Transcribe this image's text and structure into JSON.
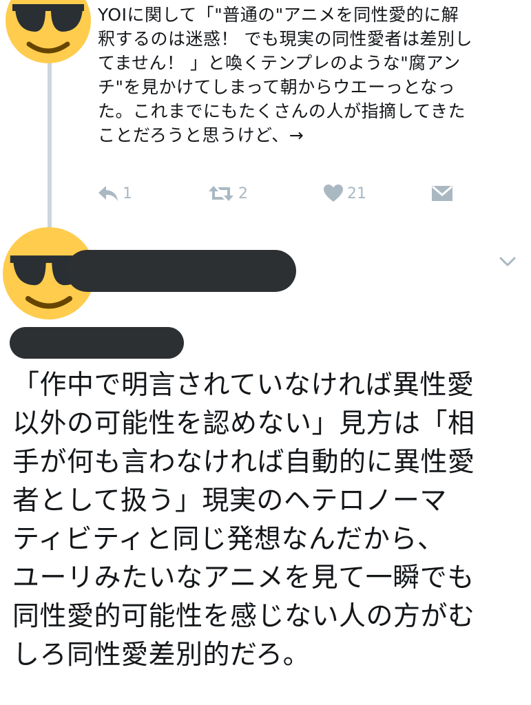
{
  "previous_tweet": {
    "text": "YOIに関して「\"普通の\"アニメを同性愛的に解\n釈するのは迷惑！ でも現実の同性愛者は差別し\nてません！ 」と喚くテンプレのような\"腐アン\nチ\"を見かけてしまって朝からウエーっとなっ\nた。これまでにもたくさんの人が指摘してきた\nことだろうと思うけど、→",
    "actions": {
      "reply_count": "1",
      "retweet_count": "2",
      "like_count": "21"
    }
  },
  "main_tweet": {
    "text": "「作中で明言されていなければ異性愛\n以外の可能性を認めない」見方は「相\n手が何も言わなければ自動的に異性愛\n者として扱う」現実のヘテロノーマ\nティビティと同じ発想なんだから、\nユーリみたいなアニメを見て一瞬でも\n同性愛的可能性を感じない人の方がむ\nしろ同性愛差別的だろ。"
  },
  "icons": {
    "avatar": "sunglasses-emoji-icon",
    "reply": "reply-icon",
    "retweet": "retweet-icon",
    "like": "heart-icon",
    "dm": "envelope-icon",
    "menu": "chevron-down-icon"
  },
  "colors": {
    "text": "#14171a",
    "action_gray": "#aab8c2",
    "thread_line": "#ccd6dd",
    "redaction": "#2d3033",
    "emoji_yellow": "#ffcc4d"
  }
}
